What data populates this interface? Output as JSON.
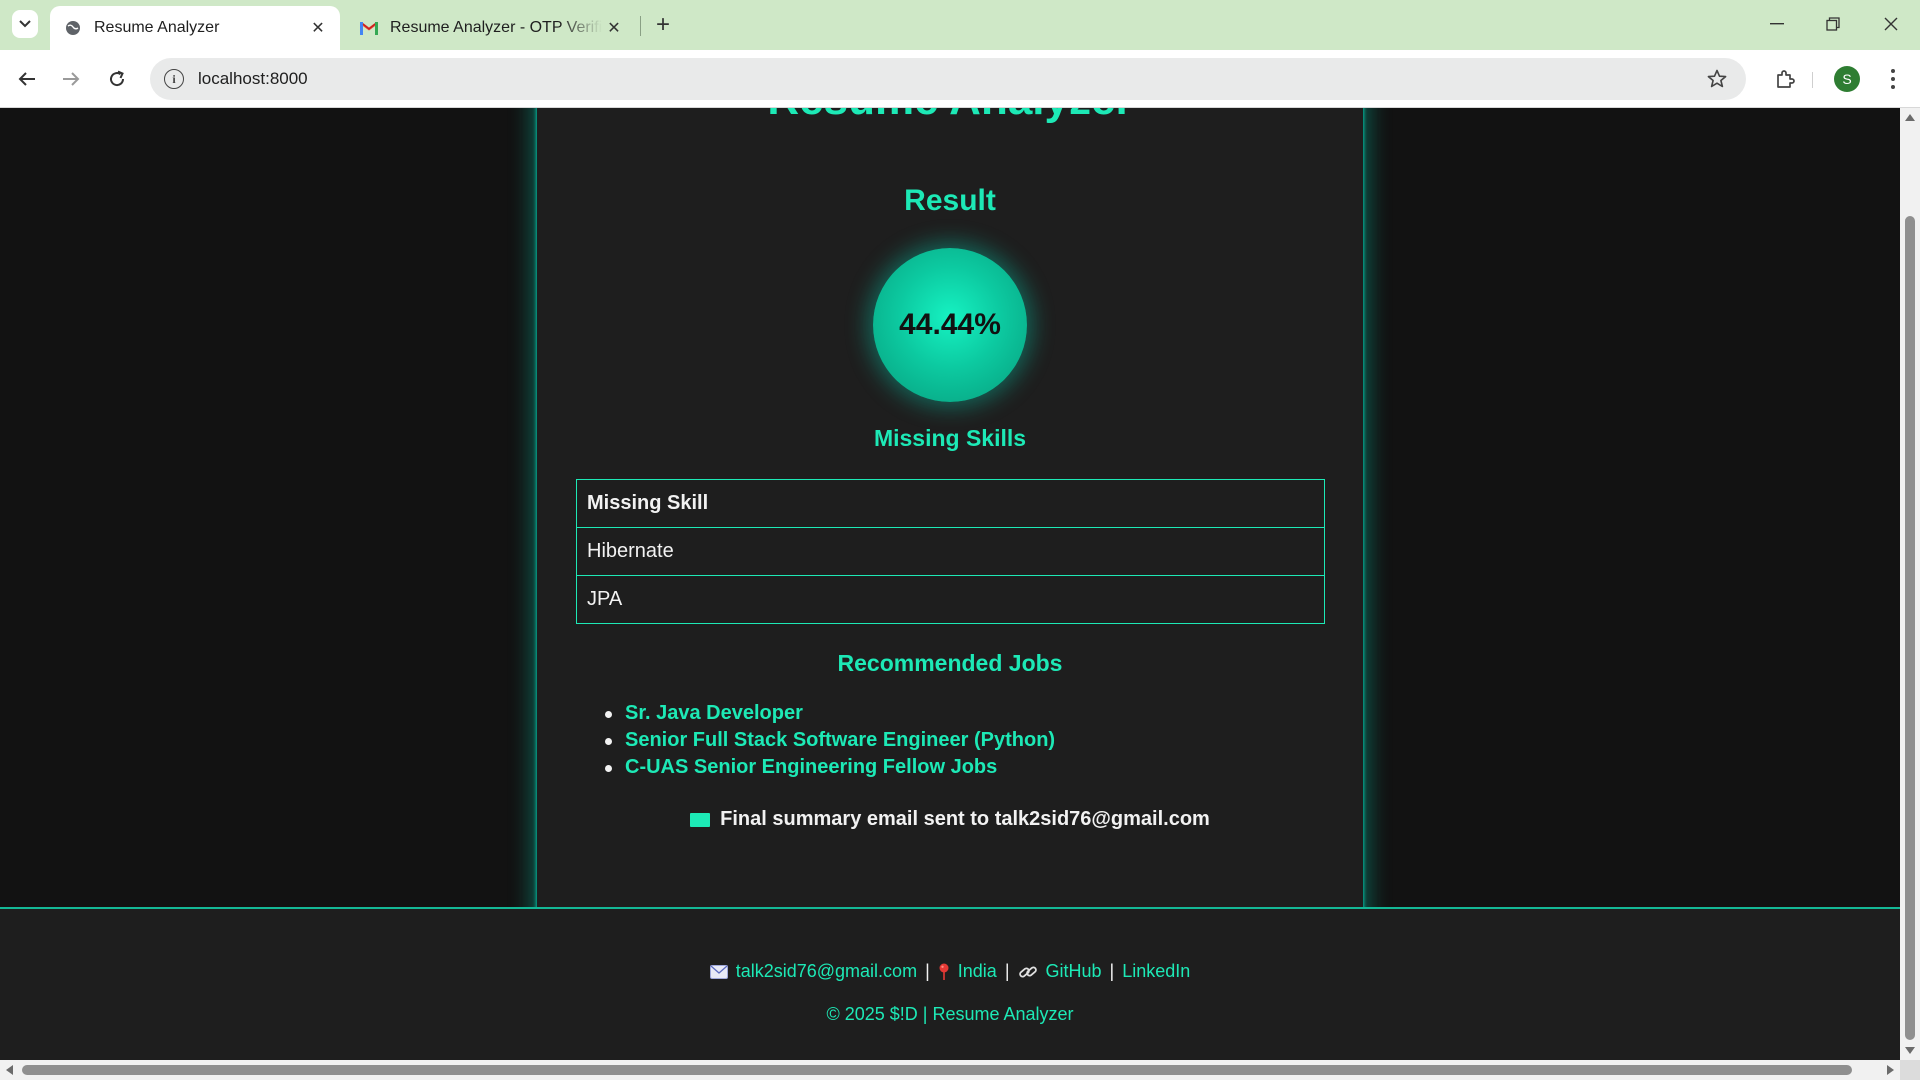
{
  "browser": {
    "tabs": [
      {
        "title": "Resume Analyzer",
        "active": true,
        "icon": "globe-icon"
      },
      {
        "title": "Resume Analyzer - OTP Verification",
        "active": false,
        "icon": "gmail-icon"
      }
    ],
    "tab_close_glyph": "✕",
    "new_tab_glyph": "+",
    "url": "localhost:8000",
    "profile_initial": "S",
    "colors": {
      "tabbar": "#cfe8c7",
      "avatar": "#2e7d32"
    }
  },
  "page": {
    "app_title": "Resume Analyzer",
    "result_heading": "Result",
    "score": "44.44%",
    "missing_skills_heading": "Missing Skills",
    "skills_table": {
      "header": "Missing Skill",
      "rows": [
        "Hibernate",
        "JPA"
      ]
    },
    "recommended_jobs_heading": "Recommended Jobs",
    "jobs": [
      "Sr. Java Developer",
      "Senior Full Stack Software Engineer (Python)",
      "C-UAS Senior Engineering Fellow Jobs"
    ],
    "email_note": "Final summary email sent to talk2sid76@gmail.com",
    "colors": {
      "accent": "#1de9b6",
      "background": "#121212",
      "card": "#1e1e1e"
    }
  },
  "footer": {
    "email": "talk2sid76@gmail.com",
    "location": "India",
    "github_label": "GitHub",
    "linkedin_label": "LinkedIn",
    "separator": "|",
    "copyright": "© 2025 $!D | Resume Analyzer",
    "icons": [
      "envelope-icon",
      "pin-icon",
      "link-icon"
    ]
  }
}
